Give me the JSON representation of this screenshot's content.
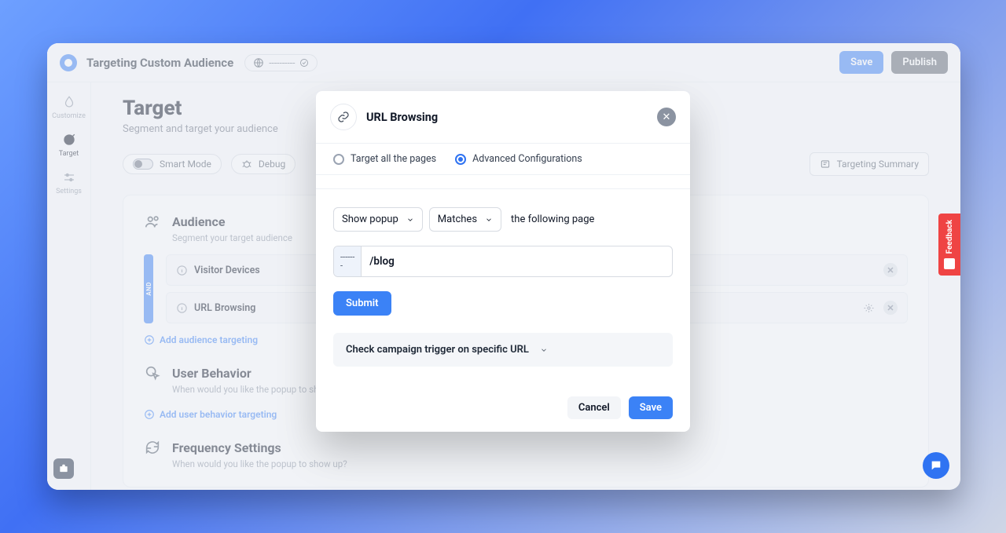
{
  "header": {
    "title": "Targeting Custom Audience",
    "domain_mask": "----------",
    "save": "Save",
    "publish": "Publish"
  },
  "sidebar": {
    "items": [
      {
        "label": "Customize"
      },
      {
        "label": "Target"
      },
      {
        "label": "Settings"
      }
    ]
  },
  "page": {
    "title": "Target",
    "subtitle": "Segment and target your audience",
    "smart_mode": "Smart Mode",
    "debug": "Debug",
    "targeting_summary": "Targeting Summary"
  },
  "audience": {
    "title": "Audience",
    "subtitle": "Segment your target audience",
    "and": "AND",
    "rows": [
      "Visitor Devices",
      "URL Browsing"
    ],
    "add": "Add audience targeting"
  },
  "behavior": {
    "title": "User Behavior",
    "subtitle": "When would you like the popup to show up?",
    "add": "Add user behavior targeting"
  },
  "frequency": {
    "title": "Frequency Settings",
    "subtitle": "When would you like the popup to show up?"
  },
  "modal": {
    "title": "URL Browsing",
    "opt_all": "Target all the pages",
    "opt_adv": "Advanced Configurations",
    "show_popup": "Show popup",
    "matches": "Matches",
    "following": "the following page",
    "url_prefix_mask": "------\n-",
    "url_value": "/blog",
    "submit": "Submit",
    "trigger_check": "Check campaign trigger on specific URL",
    "cancel": "Cancel",
    "save": "Save"
  },
  "feedback": {
    "label": "Feedback"
  }
}
